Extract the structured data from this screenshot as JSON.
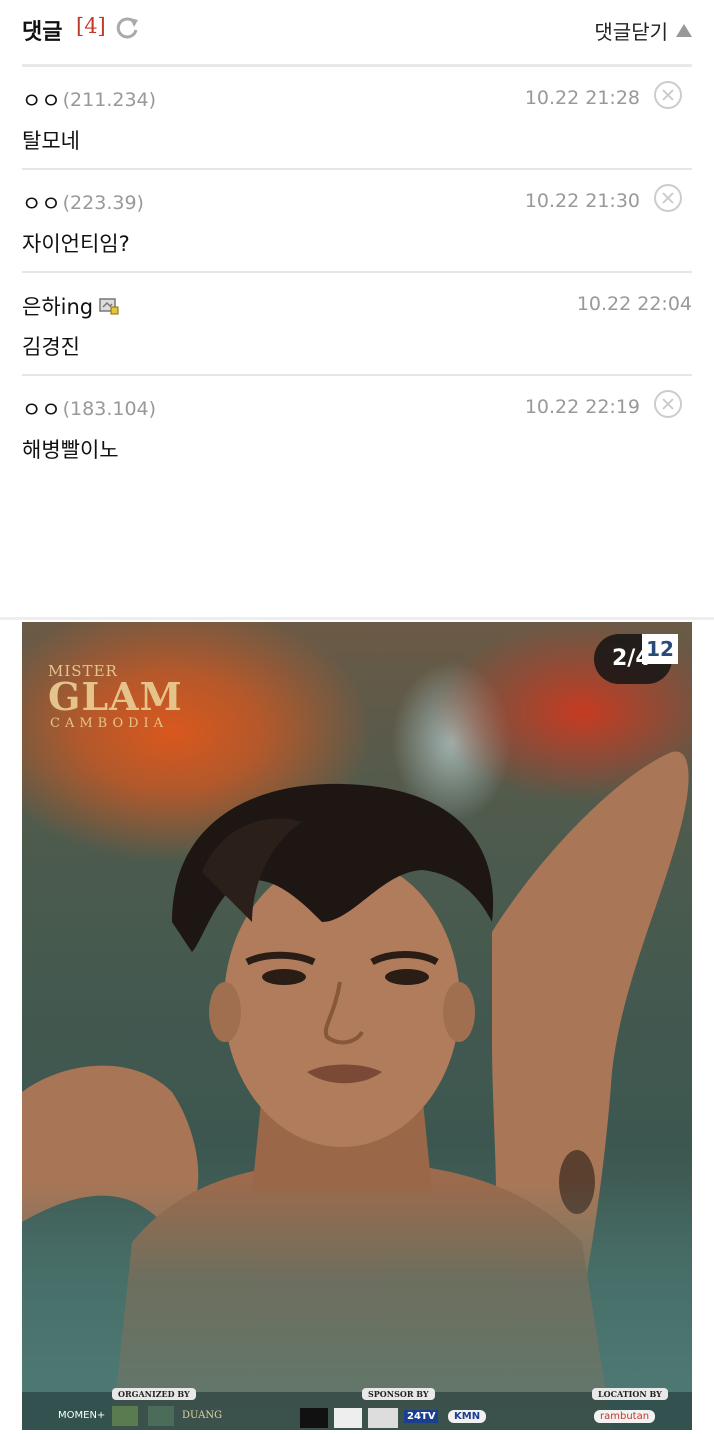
{
  "comments_header": {
    "title": "댓글",
    "count": "[4]",
    "toggle_label": "댓글닫기",
    "refresh_icon": "refresh-icon",
    "toggle_icon": "triangle-up-icon"
  },
  "comments": [
    {
      "author": "ㅇㅇ",
      "ip": "(211.234)",
      "time": "10.22 21:28",
      "text": "탈모네",
      "deletable": true
    },
    {
      "author": "ㅇㅇ",
      "ip": "(223.39)",
      "time": "10.22 21:30",
      "text": "자이언티임?",
      "deletable": true
    },
    {
      "author": "은하ing",
      "ip": "",
      "time": "10.22 22:04",
      "text": "김경진",
      "deletable": false
    },
    {
      "author": "ㅇㅇ",
      "ip": "(183.104)",
      "time": "10.22 22:19",
      "text": "해병빨이노",
      "deletable": true
    }
  ],
  "photo": {
    "logo_line1": "MISTER",
    "logo_line2": "GLAM",
    "logo_line3": "CAMBODIA",
    "page_counter": "2/4",
    "page_number": "12",
    "organized_by": "ORGANIZED BY",
    "sponsor_by": "SPONSOR BY",
    "location_by": "LOCATION BY",
    "org_logos": [
      "MOMEN+",
      "DUANG"
    ],
    "sponsor_logos": [
      "24TV",
      "KMN"
    ],
    "location_logo": "rambutan"
  },
  "colors": {
    "count_red": "#c0392b",
    "muted_gray": "#999999",
    "logo_gold": "#e4c48a"
  }
}
